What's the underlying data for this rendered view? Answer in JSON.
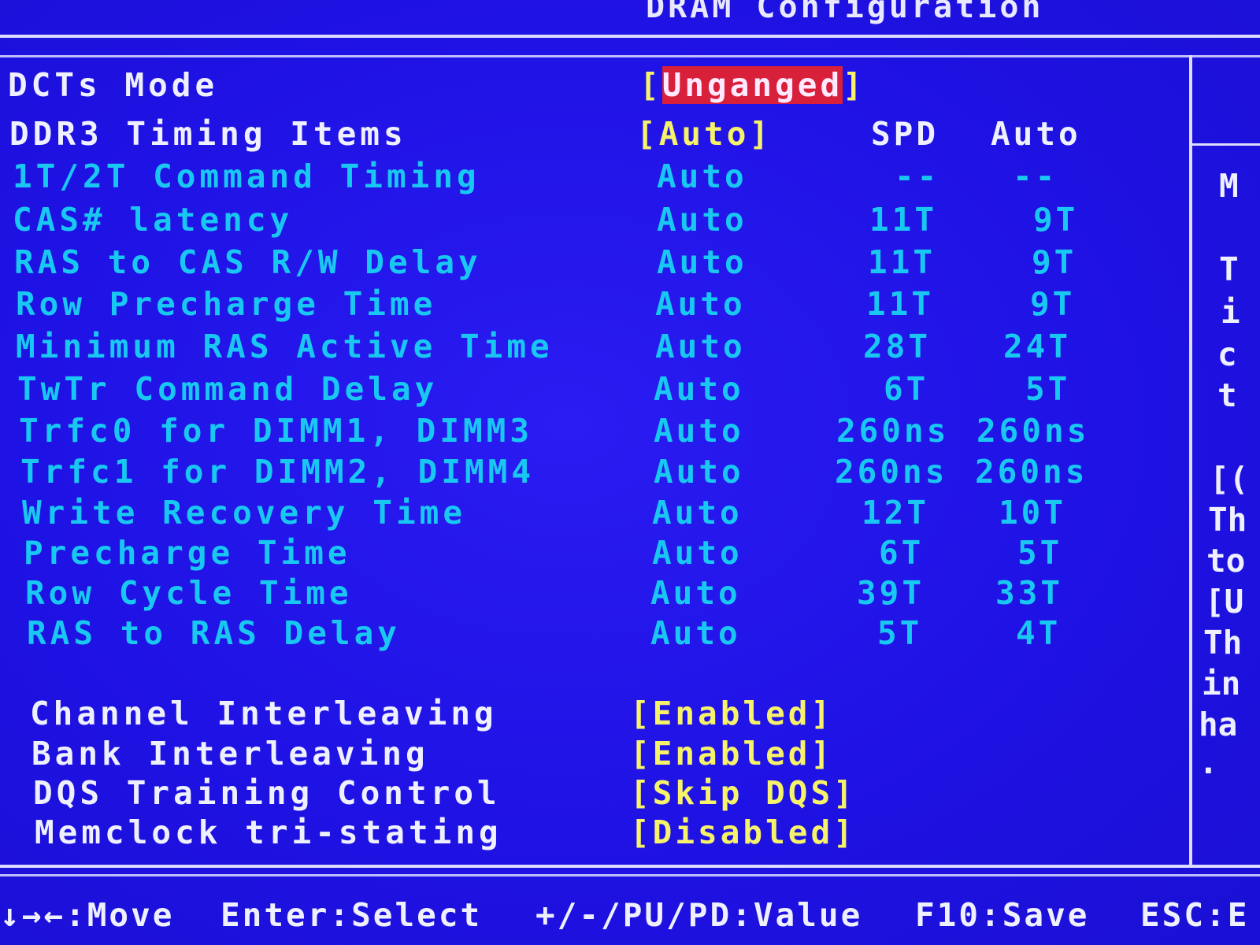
{
  "header": {
    "title": "DRAM Configuration"
  },
  "settings_top": [
    {
      "label": "DCTs Mode",
      "value": "Unganged",
      "selected": true
    },
    {
      "label": "DDR3 Timing Items",
      "value": "Auto",
      "col_spd": "SPD",
      "col_auto": "Auto"
    }
  ],
  "timings": [
    {
      "label": "1T/2T Command Timing",
      "value": "Auto",
      "spd": "--",
      "auto": "--"
    },
    {
      "label": "CAS# latency",
      "value": "Auto",
      "spd": "11T",
      "auto": "9T"
    },
    {
      "label": "RAS to CAS R/W Delay",
      "value": "Auto",
      "spd": "11T",
      "auto": "9T"
    },
    {
      "label": "Row Precharge Time",
      "value": "Auto",
      "spd": "11T",
      "auto": "9T"
    },
    {
      "label": "Minimum RAS Active Time",
      "value": "Auto",
      "spd": "28T",
      "auto": "24T"
    },
    {
      "label": "TwTr Command Delay",
      "value": "Auto",
      "spd": "6T",
      "auto": "5T"
    },
    {
      "label": "Trfc0 for DIMM1, DIMM3",
      "value": "Auto",
      "spd": "260ns",
      "auto": "260ns"
    },
    {
      "label": "Trfc1 for DIMM2, DIMM4",
      "value": "Auto",
      "spd": "260ns",
      "auto": "260ns"
    },
    {
      "label": "Write Recovery Time",
      "value": "Auto",
      "spd": "12T",
      "auto": "10T"
    },
    {
      "label": "Precharge Time",
      "value": "Auto",
      "spd": "6T",
      "auto": "5T"
    },
    {
      "label": "Row Cycle Time",
      "value": "Auto",
      "spd": "39T",
      "auto": "33T"
    },
    {
      "label": "RAS to RAS Delay",
      "value": "Auto",
      "spd": "5T",
      "auto": "4T"
    }
  ],
  "settings_bottom": [
    {
      "label": "Channel Interleaving",
      "value": "[Enabled]"
    },
    {
      "label": "Bank Interleaving",
      "value": "[Enabled]"
    },
    {
      "label": "DQS Training Control",
      "value": "[Skip DQS]"
    },
    {
      "label": "Memclock tri-stating",
      "value": "[Disabled]"
    }
  ],
  "help_panel": {
    "fragments": [
      "M",
      "T",
      "i",
      "c",
      "t",
      "[(",
      "Th",
      "to",
      "[U",
      "Th",
      "in",
      "ha",
      "."
    ]
  },
  "footer": {
    "move": "↓→←:Move",
    "select": "Enter:Select",
    "value": "+/-/PU/PD:Value",
    "save": "F10:Save",
    "esc": "ESC:E"
  },
  "colors": {
    "background": "#1f10e6",
    "label_white": "#eef0ff",
    "label_disabled_cyan": "#19c8f2",
    "value_yellow": "#f6f36a",
    "highlight_red": "#d8203a"
  }
}
